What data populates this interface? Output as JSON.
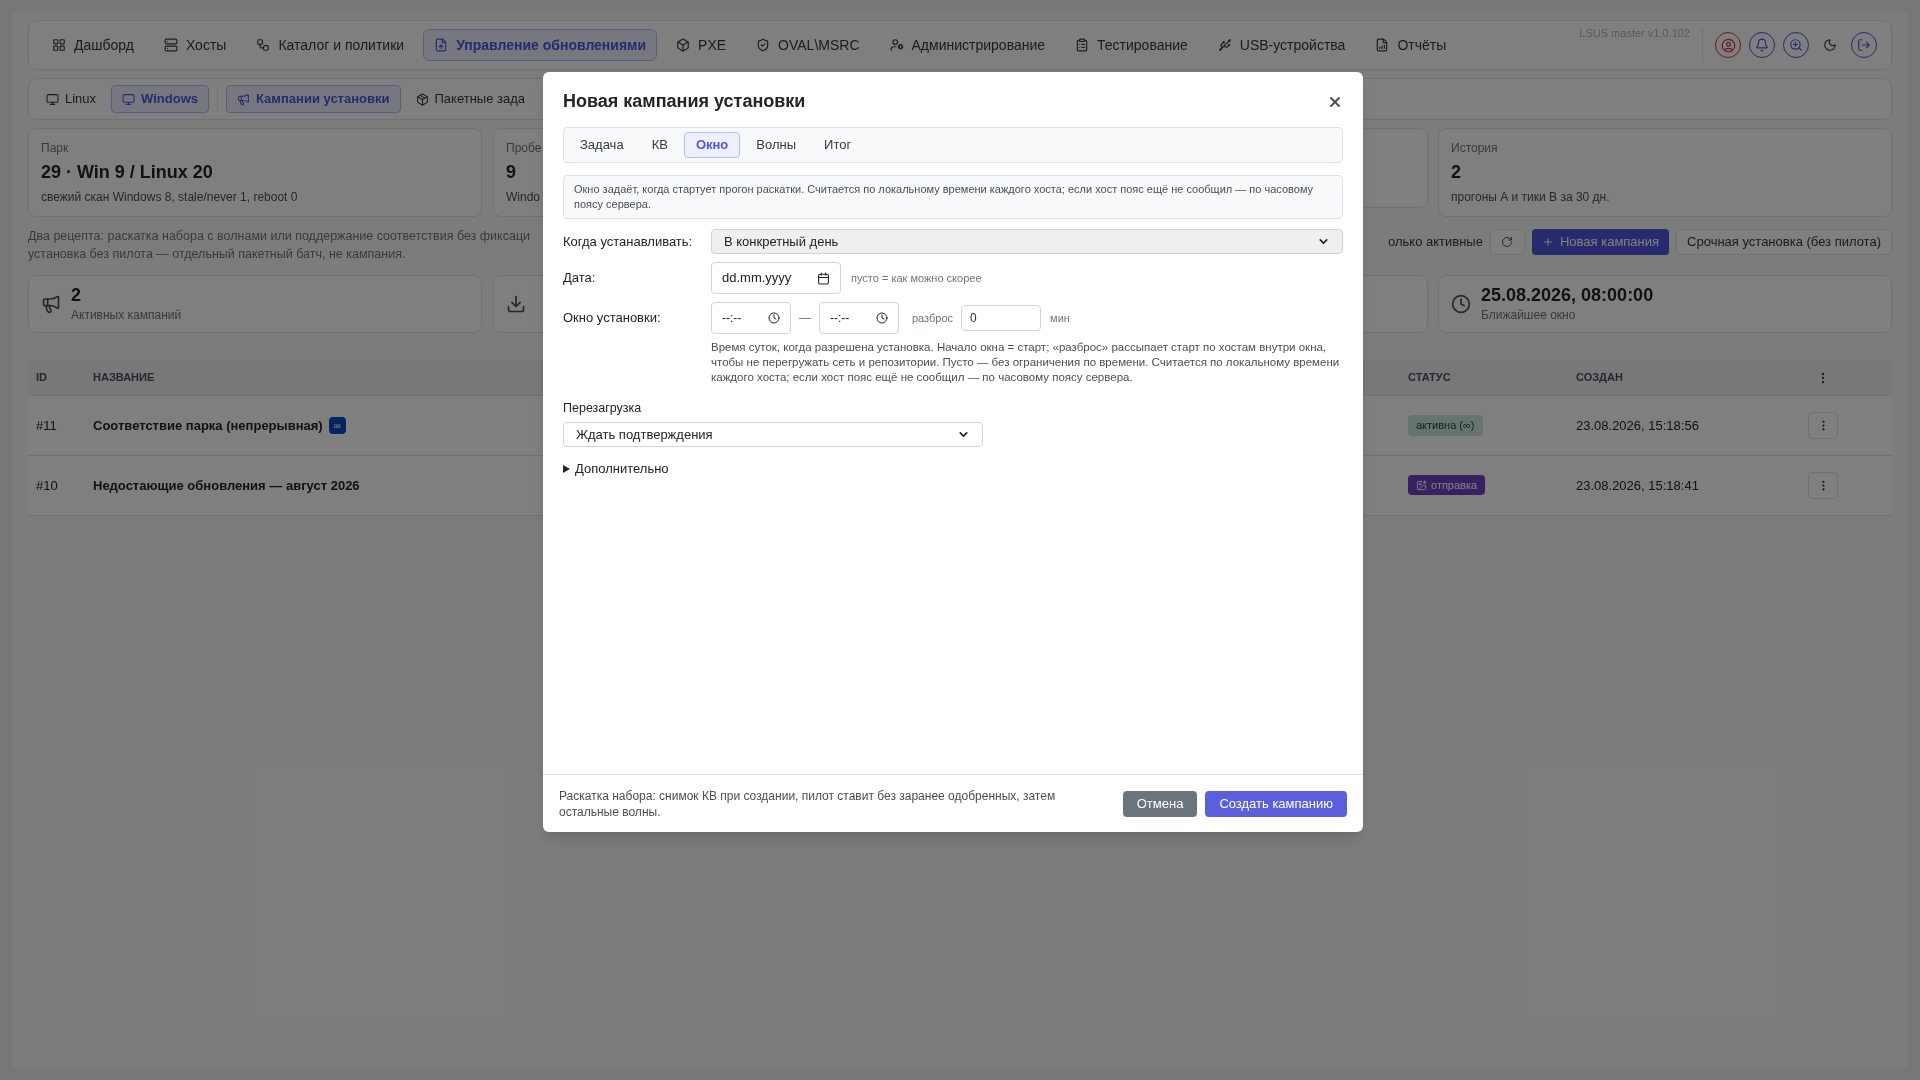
{
  "nav": {
    "items": [
      {
        "label": "Дашборд",
        "selected": false
      },
      {
        "label": "Хосты",
        "selected": false
      },
      {
        "label": "Каталог и политики",
        "selected": false
      },
      {
        "label": "Управление обновлениями",
        "selected": true
      },
      {
        "label": "PXE",
        "selected": false
      },
      {
        "label": "OVAL\\MSRC",
        "selected": false
      },
      {
        "label": "Администрирование",
        "selected": false
      },
      {
        "label": "Тестирование",
        "selected": false
      },
      {
        "label": "USB-устройства",
        "selected": false
      },
      {
        "label": "Отчёты",
        "selected": false
      }
    ],
    "version": "LSUS master v1.0.102"
  },
  "os_toggle": [
    {
      "label": "Linux",
      "selected": false
    },
    {
      "label": "Windows",
      "selected": true
    }
  ],
  "section_tabs": [
    {
      "label": "Кампании установки",
      "selected": true
    },
    {
      "label": "Пакетные зада",
      "selected": false
    }
  ],
  "stats": {
    "left": [
      {
        "label": "Парк",
        "value": "29 · Win 9 / Linux 20",
        "note": "свежий скан Windows 8, stale/never 1, reboot 0"
      },
      {
        "label": "Пробе",
        "value": "9",
        "note": "Windo"
      }
    ],
    "right": [
      {
        "label": "История",
        "value": "2",
        "note": "прогоны А и тики В за 30 дн."
      }
    ]
  },
  "description": [
    "Два рецепта: раскатка набора с волнами или поддержание соответствия без фиксаци",
    "установка без пилота — отдельный пакетный батч, не кампания."
  ],
  "actions": {
    "filter_label": "олько активные",
    "new_button": "Новая кампания",
    "urgent_button": "Срочная установка (без пилота)"
  },
  "kpis": {
    "left": [
      {
        "value": "2",
        "label": "Активных кампаний"
      }
    ],
    "right": [
      {
        "value": "25.08.2026, 08:00:00",
        "label": "Ближайшее окно"
      }
    ]
  },
  "table": {
    "columns": [
      "ID",
      "НАЗВАНИЕ",
      "СТАТУС",
      "СОЗДАН"
    ],
    "rows": [
      {
        "id": "#11",
        "name": "Соответствие парка (непрерывная)",
        "badge": "∞",
        "status": {
          "kind": "active",
          "text": "активна (∞)"
        },
        "created": "23.08.2026, 15:18:56"
      },
      {
        "id": "#10",
        "name": "Недостающие обновления — август 2026",
        "status": {
          "kind": "sending",
          "text": "отправка"
        },
        "created": "23.08.2026, 15:18:41"
      }
    ]
  },
  "dialog": {
    "title": "Новая кампания установки",
    "tabs": [
      {
        "label": "Задача",
        "selected": false
      },
      {
        "label": "КВ",
        "selected": false
      },
      {
        "label": "Окно",
        "selected": true
      },
      {
        "label": "Волны",
        "selected": false
      },
      {
        "label": "Итог",
        "selected": false
      }
    ],
    "info": "Окно задаёт, когда стартует прогон раскатки. Считается по локальному времени каждого хоста; если хост пояс ещё не сообщил — по часовому поясу сервера.",
    "when": {
      "label": "Когда устанавливать:",
      "value": "В конкретный день"
    },
    "date": {
      "label": "Дата:",
      "value": "dd.mm.yyyy",
      "hint": "пусто = как можно скорее"
    },
    "window": {
      "label": "Окно установки:",
      "from": "--:--",
      "dash": "—",
      "to": "--:--",
      "spread_label": "разброс",
      "spread": "0",
      "unit": "мин",
      "help": "Время суток, когда разрешена установка. Начало окна = старт; «разброс» рассыпает старт по хостам внутри окна, чтобы не перегружать сеть и репозитории. Пусто — без ограничения по времени. Считается по локальному времени каждого хоста; если хост пояс ещё не сообщил — по часовому поясу сервера."
    },
    "reboot": {
      "label": "Перезагрузка",
      "value": "Ждать подтверждения"
    },
    "advanced": {
      "label": "Дополнительно",
      "expanded": false
    },
    "footer_note": "Раскатка набора: снимок КВ при создании, пилот ставит без заранее одобренных, затем остальные волны.",
    "cancel": "Отмена",
    "submit": "Создать кампанию"
  }
}
